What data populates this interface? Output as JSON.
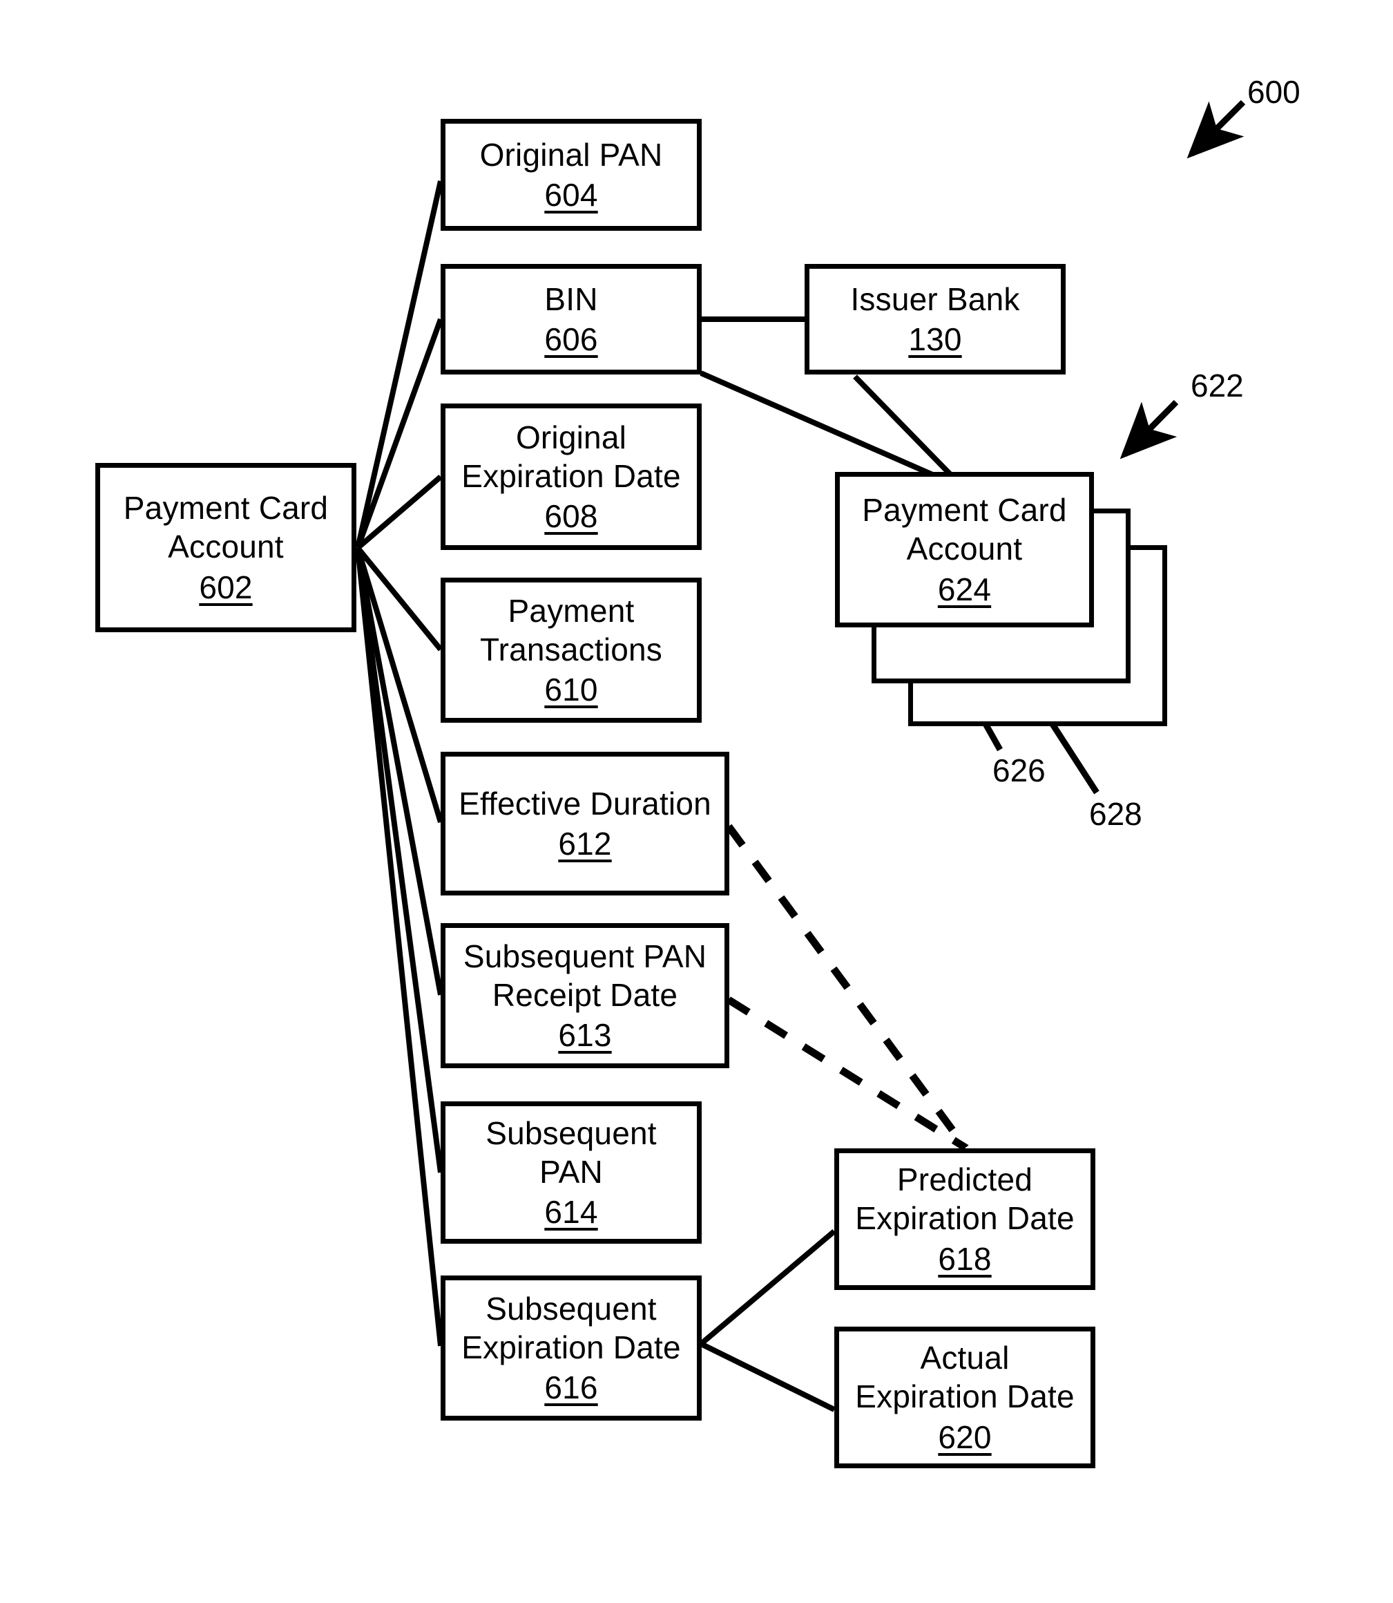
{
  "figure": {
    "number": "600",
    "callouts": {
      "fig_number": "600",
      "account_collection": "622",
      "stacked_second": "626",
      "stacked_third": "628"
    }
  },
  "nodes": {
    "payment_card_account": {
      "title": "Payment Card\nAccount",
      "ref": "602"
    },
    "original_pan": {
      "title": "Original PAN",
      "ref": "604"
    },
    "bin": {
      "title": "BIN",
      "ref": "606"
    },
    "issuer_bank": {
      "title": "Issuer Bank",
      "ref": "130"
    },
    "original_expiration": {
      "title": "Original\nExpiration Date",
      "ref": "608"
    },
    "payment_transactions": {
      "title": "Payment\nTransactions",
      "ref": "610"
    },
    "effective_duration": {
      "title": "Effective Duration",
      "ref": "612"
    },
    "subsequent_pan_receipt": {
      "title": "Subsequent PAN\nReceipt Date",
      "ref": "613"
    },
    "subsequent_pan": {
      "title": "Subsequent PAN",
      "ref": "614"
    },
    "subsequent_expiration": {
      "title": "Subsequent\nExpiration Date",
      "ref": "616"
    },
    "predicted_expiration": {
      "title": "Predicted\nExpiration Date",
      "ref": "618"
    },
    "actual_expiration": {
      "title": "Actual\nExpiration Date",
      "ref": "620"
    },
    "stacked_account": {
      "title": "Payment Card\nAccount",
      "ref": "624"
    }
  },
  "colors": {
    "stroke": "#000000",
    "fill": "#ffffff"
  }
}
